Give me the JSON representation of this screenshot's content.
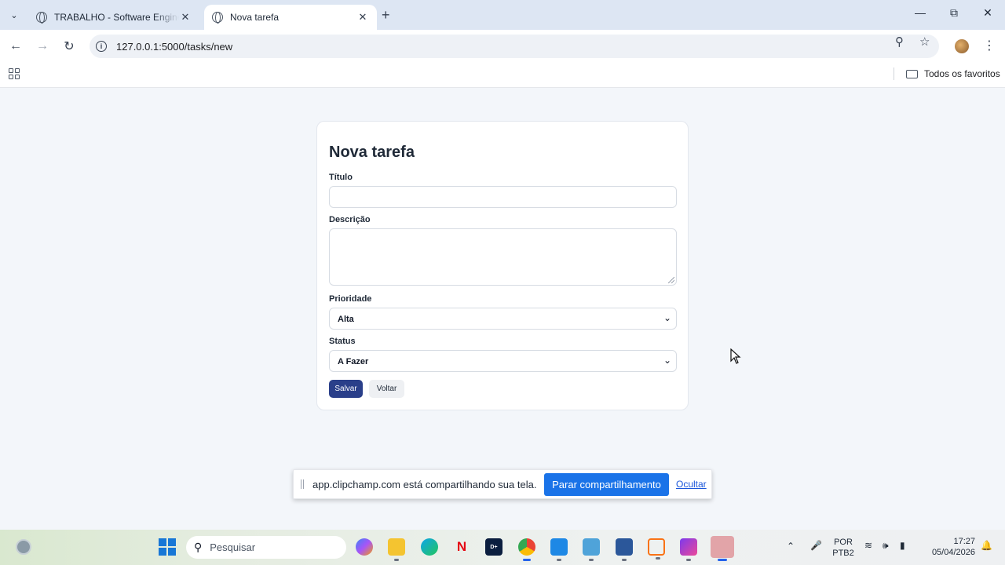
{
  "browser": {
    "tabs": [
      {
        "title": "TRABALHO - Software Engineer",
        "active": false
      },
      {
        "title": "Nova tarefa",
        "active": true
      }
    ],
    "url": "127.0.0.1:5000/tasks/new",
    "bookmarks_folder": "Todos os favoritos"
  },
  "form": {
    "title": "Nova tarefa",
    "titulo_label": "Título",
    "titulo_value": "",
    "descricao_label": "Descrição",
    "descricao_value": "",
    "prioridade_label": "Prioridade",
    "prioridade_value": "Alta",
    "status_label": "Status",
    "status_value": "A Fazer",
    "save_label": "Salvar",
    "back_label": "Voltar"
  },
  "sharing": {
    "message": "app.clipchamp.com está compartilhando sua tela.",
    "stop_label": "Parar compartilhamento",
    "hide_label": "Ocultar"
  },
  "taskbar": {
    "search_placeholder": "Pesquisar",
    "language_line1": "POR",
    "language_line2": "PTB2",
    "time": "17:27",
    "date": "05/04/2026",
    "apps": [
      "copilot-icon",
      "file-explorer-icon",
      "edge-icon",
      "netflix-icon",
      "disney-plus-icon",
      "chrome-icon",
      "vscode-icon",
      "notepad-icon",
      "word-icon",
      "snipping-tool-icon",
      "clipchamp-icon",
      "tablet-app-icon"
    ]
  },
  "colors": {
    "primary_button": "#2a3f8a",
    "share_button": "#1a73e8",
    "page_background": "#f3f6fa"
  }
}
